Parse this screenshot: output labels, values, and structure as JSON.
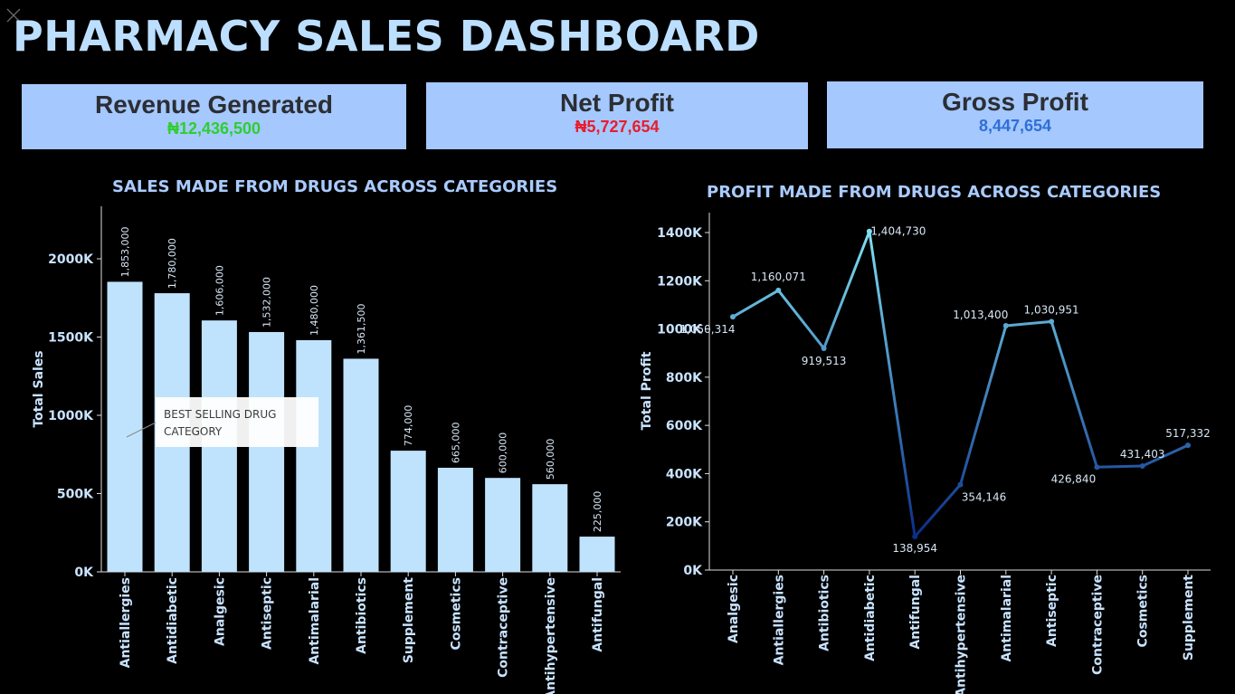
{
  "title": "PHARMACY SALES DASHBOARD",
  "kpis": {
    "revenue": {
      "label": "Revenue Generated",
      "value": "₦12,436,500",
      "color": "#2fce2f"
    },
    "net_profit": {
      "label": "Net Profit",
      "value": "₦5,727,654",
      "color": "#e81d2d"
    },
    "gross_profit": {
      "label": "Gross Profit",
      "value": "8,447,654",
      "color": "#2f6fd6"
    }
  },
  "sales_chart_title": "SALES MADE FROM DRUGS ACROSS CATEGORIES",
  "profit_chart_title": "PROFIT MADE FROM DRUGS ACROSS CATEGORIES",
  "annotation": "BEST SELLING DRUG CATEGORY",
  "chart_data": [
    {
      "type": "bar",
      "title": "SALES MADE FROM DRUGS ACROSS CATEGORIES",
      "xlabel": "",
      "ylabel": "Total Sales",
      "ylim": [
        0,
        2300000
      ],
      "yticks": [
        0,
        500000,
        1000000,
        1500000,
        2000000
      ],
      "ytick_labels": [
        "0K",
        "500K",
        "1000K",
        "1500K",
        "2000K"
      ],
      "categories": [
        "Antiallergies",
        "Antidiabetic",
        "Analgesic",
        "Antiseptic",
        "Antimalarial",
        "Antibiotics",
        "Supplement",
        "Cosmetics",
        "Contraceptive",
        "Antihypertensive",
        "Antifungal"
      ],
      "values": [
        1853000,
        1780000,
        1606000,
        1532000,
        1480000,
        1361500,
        774000,
        665000,
        600000,
        560000,
        225000
      ],
      "value_labels": [
        "1,853,000",
        "1,780,000",
        "1,606,000",
        "1,532,000",
        "1,480,000",
        "1,361,500",
        "774,000",
        "665,000",
        "600,000",
        "560,000",
        "225,000"
      ],
      "bar_color": "#bfe3fd"
    },
    {
      "type": "line",
      "title": "PROFIT MADE FROM DRUGS ACROSS CATEGORIES",
      "xlabel": "",
      "ylabel": "Total Profit",
      "ylim": [
        0,
        1450000
      ],
      "yticks": [
        0,
        200000,
        400000,
        600000,
        800000,
        1000000,
        1200000,
        1400000
      ],
      "ytick_labels": [
        "0K",
        "200K",
        "400K",
        "600K",
        "800K",
        "1000K",
        "1200K",
        "1400K"
      ],
      "categories": [
        "Analgesic",
        "Antiallergies",
        "Antibiotics",
        "Antidiabetic",
        "Antifungal",
        "Antihypertensive",
        "Antimalarial",
        "Antiseptic",
        "Contraceptive",
        "Cosmetics",
        "Supplement"
      ],
      "values": [
        1050314,
        1160071,
        919513,
        1404730,
        138954,
        354146,
        1013400,
        1030951,
        426840,
        431403,
        517332
      ],
      "value_labels": [
        "1,050,314",
        "1,160,071",
        "919,513",
        "1,404,730",
        "138,954",
        "354,146",
        "1,013,400",
        "1,030,951",
        "426,840",
        "431,403",
        "517,332"
      ],
      "color_scale": [
        "#0a2f8a",
        "#7fe0f2"
      ]
    }
  ]
}
